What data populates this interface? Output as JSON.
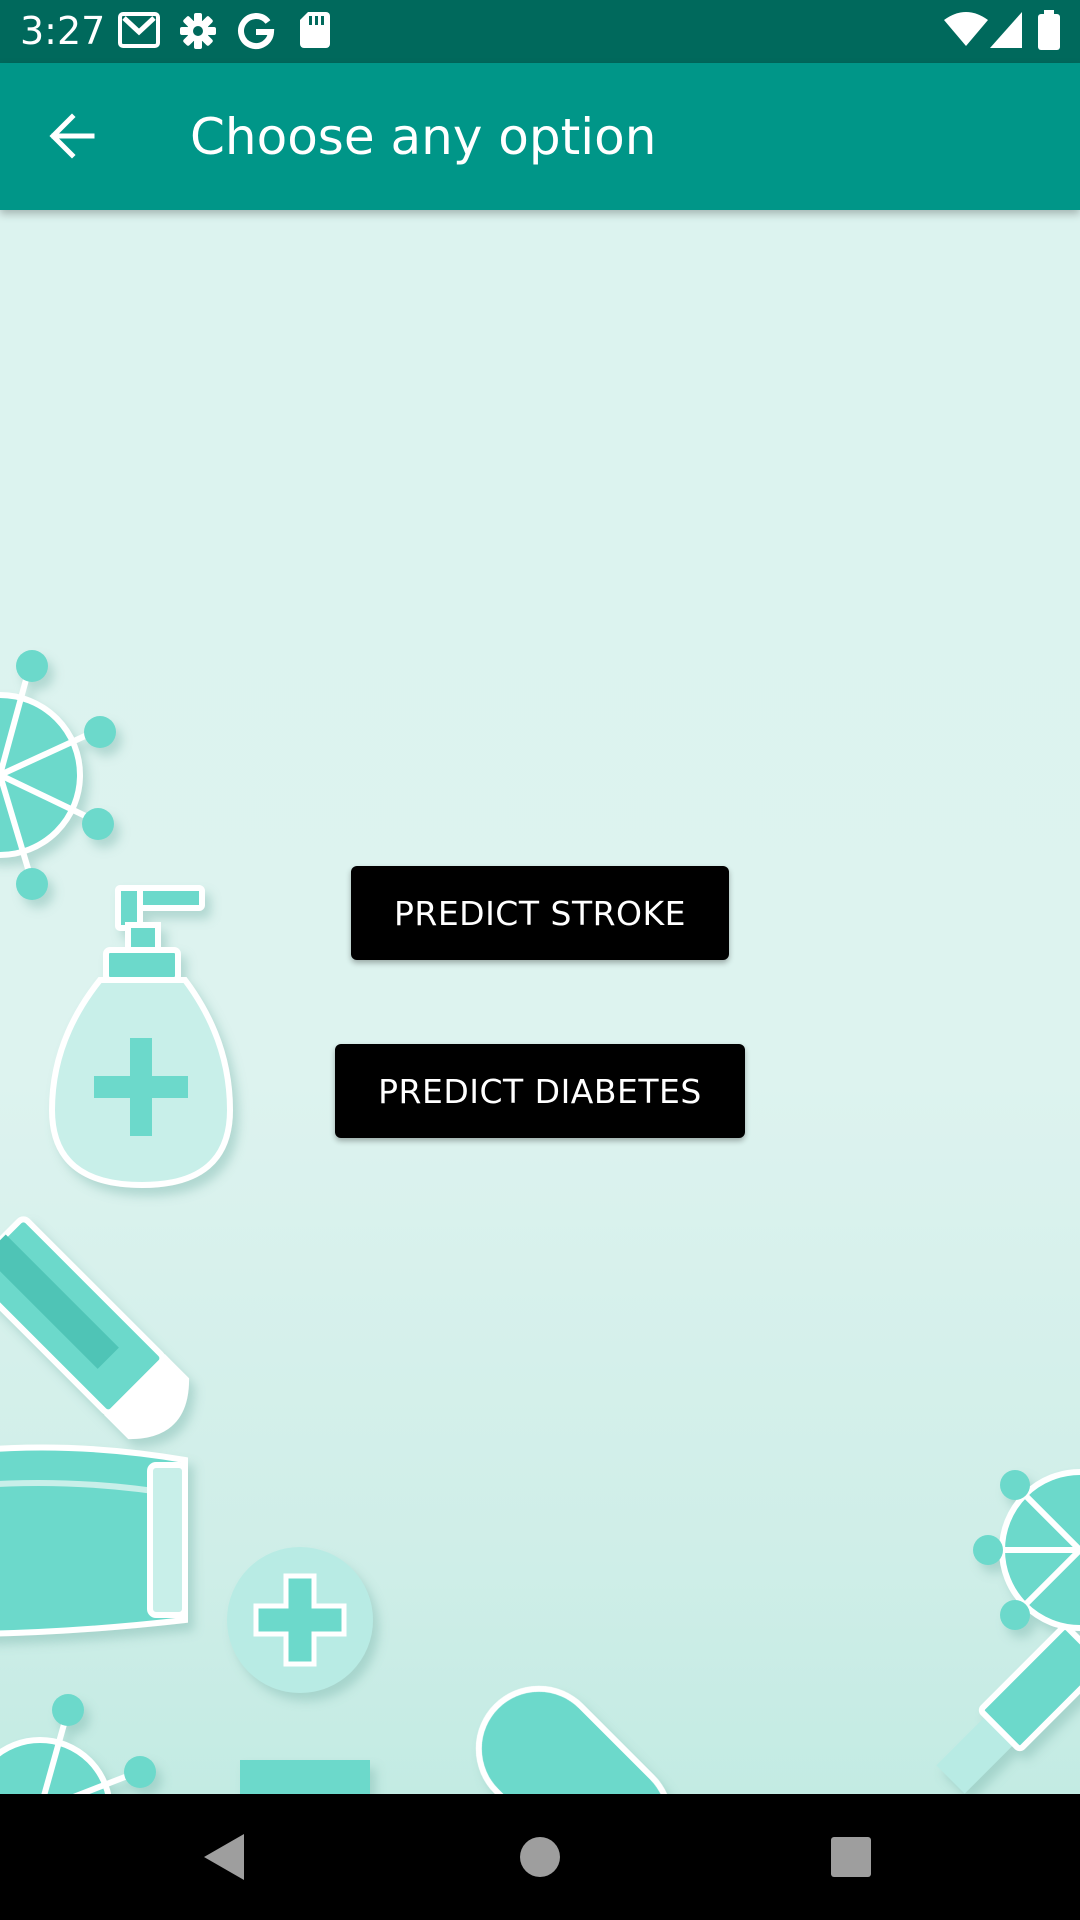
{
  "status_bar": {
    "time": "3:27",
    "left_icons": [
      "gmail-icon",
      "settings-gear-icon",
      "google-g-icon",
      "sd-card-icon"
    ],
    "right_icons": [
      "wifi-icon",
      "signal-icon",
      "battery-icon"
    ]
  },
  "app_bar": {
    "back_icon": "arrow-back-icon",
    "title": "Choose any option"
  },
  "buttons": {
    "predict_stroke": "PREDICT STROKE",
    "predict_diabetes": "PREDICT DIABETES"
  },
  "nav_bar": {
    "icons": [
      "nav-back-icon",
      "nav-home-icon",
      "nav-recents-icon"
    ]
  },
  "colors": {
    "status_bar": "#00695c",
    "app_bar": "#009688",
    "background": "#dcf3ef",
    "illustration_teal": "#6cd9cb",
    "button": "#000000"
  }
}
